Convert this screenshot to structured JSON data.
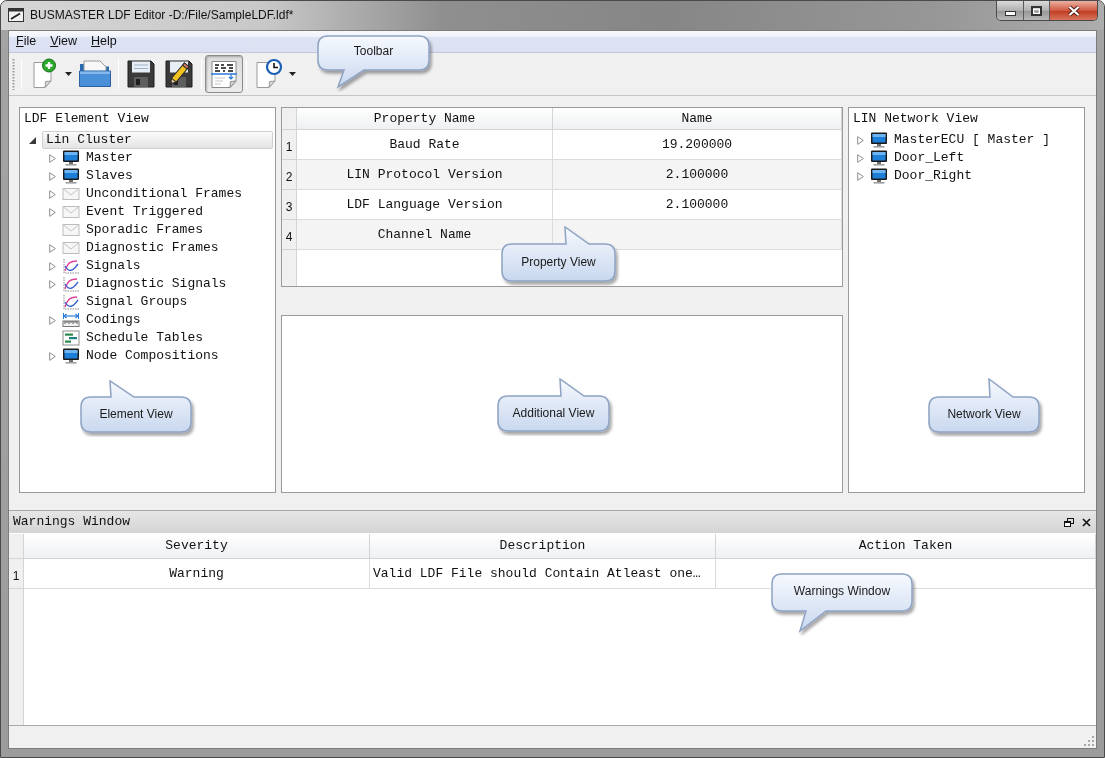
{
  "window": {
    "title": "BUSMASTER LDF Editor -D:/File/SampleLDF.ldf*"
  },
  "menu": [
    "File",
    "View",
    "Help"
  ],
  "toolbar": {
    "groups": [
      [
        {
          "kind": "dropdown",
          "pressed": false
        },
        {
          "kind": "button",
          "pressed": false
        }
      ],
      [
        {
          "kind": "button",
          "pressed": false
        },
        {
          "kind": "button",
          "pressed": false
        }
      ],
      [
        {
          "kind": "button",
          "pressed": true
        }
      ],
      [
        {
          "kind": "dropdown",
          "pressed": false
        }
      ]
    ],
    "callout": "Toolbar"
  },
  "element_view": {
    "title": "LDF Element View",
    "tree": [
      {
        "label": "Lin Cluster",
        "expanded": true,
        "selected": true,
        "children": [
          {
            "label": "Master",
            "kind": "node",
            "expanded": false,
            "selected": false
          },
          {
            "label": "Slaves",
            "kind": "node",
            "expanded": false,
            "selected": false
          },
          {
            "label": "Unconditional Frames",
            "kind": "frame",
            "expanded": false,
            "selected": false
          },
          {
            "label": "Event Triggered",
            "kind": "frame",
            "expanded": false,
            "selected": false
          },
          {
            "label": "Sporadic Frames",
            "kind": "frame",
            "selected": false
          },
          {
            "label": "Diagnostic Frames",
            "kind": "frame",
            "expanded": false,
            "selected": false
          },
          {
            "label": "Signals",
            "kind": "signal",
            "expanded": false,
            "selected": false
          },
          {
            "label": "Diagnostic Signals",
            "kind": "signal",
            "expanded": false,
            "selected": false
          },
          {
            "label": "Signal Groups",
            "kind": "signal",
            "selected": false
          },
          {
            "label": "Codings",
            "kind": "coding",
            "expanded": false,
            "selected": false
          },
          {
            "label": "Schedule Tables",
            "kind": "schedule",
            "selected": false
          },
          {
            "label": "Node Compositions",
            "kind": "node",
            "expanded": false,
            "selected": false
          }
        ]
      }
    ],
    "callout": "Element View"
  },
  "property_view": {
    "columns": [
      "Property Name",
      "Name"
    ],
    "rows": [
      {
        "number": "1",
        "cells": [
          "Baud Rate",
          "19.200000"
        ]
      },
      {
        "number": "2",
        "cells": [
          "LIN Protocol Version",
          "2.100000"
        ]
      },
      {
        "number": "3",
        "cells": [
          "LDF Language Version",
          "2.100000"
        ]
      },
      {
        "number": "4",
        "cells": [
          "Channel Name"
        ]
      }
    ],
    "callout": "Property View"
  },
  "additional_view": {
    "callout": "Additional View"
  },
  "network_view": {
    "title": "LIN Network View",
    "tree": [
      {
        "label": "MasterECU [ Master ]",
        "kind": "node",
        "expanded": false,
        "selected": false
      },
      {
        "label": "Door_Left",
        "kind": "node",
        "expanded": false,
        "selected": false
      },
      {
        "label": "Door_Right",
        "kind": "node",
        "expanded": false,
        "selected": false
      }
    ],
    "callout": "Network View"
  },
  "warnings_window": {
    "title": "Warnings Window",
    "columns": [
      "Severity",
      "Description",
      "Action Taken"
    ],
    "rows": [
      {
        "number": "1",
        "cells": [
          "Warning",
          "Valid LDF File should Contain Atleast one…"
        ]
      }
    ],
    "callout": "Warnings Window"
  }
}
